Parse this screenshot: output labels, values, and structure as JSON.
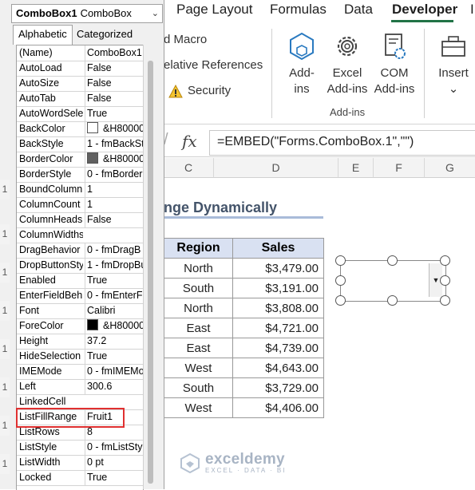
{
  "ribbon": {
    "tabs": [
      "Page Layout",
      "Formulas",
      "Data",
      "Developer",
      "I"
    ],
    "active_tab": "Developer",
    "code_items": [
      "d Macro",
      "elative References",
      "Security"
    ],
    "buttons": [
      {
        "label1": "Add-",
        "label2": "ins"
      },
      {
        "label1": "Excel",
        "label2": "Add-ins"
      },
      {
        "label1": "COM",
        "label2": "Add-ins"
      },
      {
        "label1": "Insert",
        "label2": "⌄"
      }
    ],
    "group_label": "Add-ins"
  },
  "formula_bar": {
    "fx": "fx",
    "text": "=EMBED(\"Forms.ComboBox.1\",\"\")"
  },
  "columns": [
    "C",
    "D",
    "E",
    "F",
    "G"
  ],
  "row_numbers": [
    "1",
    "1",
    "1",
    "1",
    "1",
    "1",
    "1",
    "1"
  ],
  "sheet": {
    "title": "nge Dynamically",
    "table": {
      "headers": [
        "Region",
        "Sales"
      ],
      "rows": [
        [
          "North",
          "$3,479.00"
        ],
        [
          "South",
          "$3,191.00"
        ],
        [
          "North",
          "$3,808.00"
        ],
        [
          "East",
          "$4,721.00"
        ],
        [
          "East",
          "$4,739.00"
        ],
        [
          "West",
          "$4,643.00"
        ],
        [
          "South",
          "$3,729.00"
        ],
        [
          "West",
          "$4,406.00"
        ]
      ]
    }
  },
  "watermark": {
    "title": "exceldemy",
    "subtitle": "EXCEL · DATA · BI"
  },
  "properties": {
    "object_name": "ComboBox1",
    "object_type": "ComboBox",
    "tabs": [
      "Alphabetic",
      "Categorized"
    ],
    "rows": [
      {
        "name": "(Name)",
        "value": "ComboBox1"
      },
      {
        "name": "AutoLoad",
        "value": "False"
      },
      {
        "name": "AutoSize",
        "value": "False"
      },
      {
        "name": "AutoTab",
        "value": "False"
      },
      {
        "name": "AutoWordSele",
        "value": "True"
      },
      {
        "name": "BackColor",
        "value": "&H80000",
        "swatch": "#ffffff"
      },
      {
        "name": "BackStyle",
        "value": "1 - fmBackSt"
      },
      {
        "name": "BorderColor",
        "value": "&H80000",
        "swatch": "#606060"
      },
      {
        "name": "BorderStyle",
        "value": "0 - fmBorder"
      },
      {
        "name": "BoundColumn",
        "value": "1"
      },
      {
        "name": "ColumnCount",
        "value": "1"
      },
      {
        "name": "ColumnHeads",
        "value": "False"
      },
      {
        "name": "ColumnWidths",
        "value": ""
      },
      {
        "name": "DragBehavior",
        "value": "0 - fmDragB"
      },
      {
        "name": "DropButtonSty",
        "value": "1 - fmDropBu"
      },
      {
        "name": "Enabled",
        "value": "True"
      },
      {
        "name": "EnterFieldBeh",
        "value": "0 - fmEnterF"
      },
      {
        "name": "Font",
        "value": "Calibri"
      },
      {
        "name": "ForeColor",
        "value": "&H80000",
        "swatch": "#000000"
      },
      {
        "name": "Height",
        "value": "37.2"
      },
      {
        "name": "HideSelection",
        "value": "True"
      },
      {
        "name": "IMEMode",
        "value": "0 - fmIMEMo"
      },
      {
        "name": "Left",
        "value": "300.6"
      },
      {
        "name": "LinkedCell",
        "value": ""
      },
      {
        "name": "ListFillRange",
        "value": "Fruit1"
      },
      {
        "name": "ListRows",
        "value": "8"
      },
      {
        "name": "ListStyle",
        "value": "0 - fmListSty"
      },
      {
        "name": "ListWidth",
        "value": "0 pt"
      },
      {
        "name": "Locked",
        "value": "True"
      }
    ]
  }
}
